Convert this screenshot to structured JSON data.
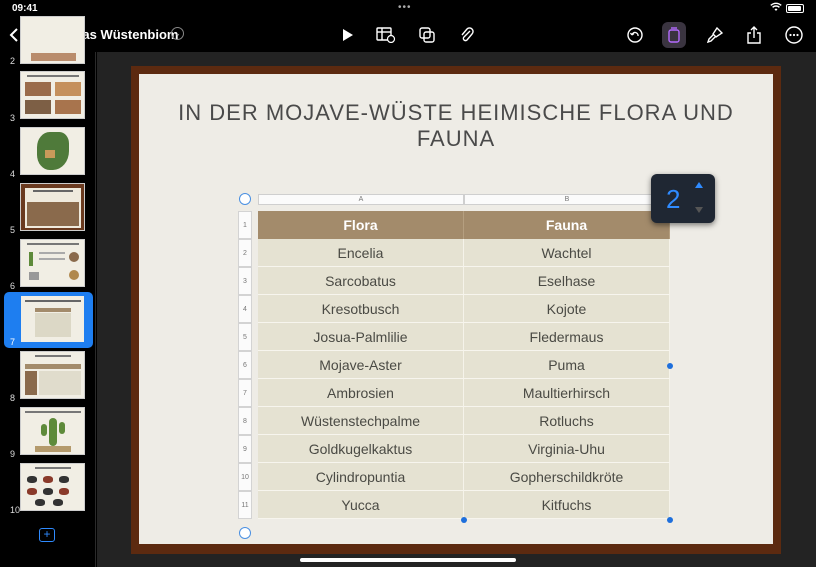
{
  "status": {
    "time": "09:41"
  },
  "toolbar": {
    "doc_title": "Das Wüstenbiom"
  },
  "sidebar": {
    "slides": [
      {
        "num": "2"
      },
      {
        "num": "3"
      },
      {
        "num": "4"
      },
      {
        "num": "5"
      },
      {
        "num": "6"
      },
      {
        "num": "7"
      },
      {
        "num": "8"
      },
      {
        "num": "9"
      },
      {
        "num": "10"
      }
    ]
  },
  "slide": {
    "title": "IN DER MOJAVE-WÜSTE HEIMISCHE FLORA UND FAUNA",
    "table": {
      "col_labels": [
        "A",
        "B"
      ],
      "headers": [
        "Flora",
        "Fauna"
      ],
      "row_labels": [
        "1",
        "2",
        "3",
        "4",
        "5",
        "6",
        "7",
        "8",
        "9",
        "10",
        "11"
      ],
      "rows": [
        [
          "Encelia",
          "Wachtel"
        ],
        [
          "Sarcobatus",
          "Eselhase"
        ],
        [
          "Kresotbusch",
          "Kojote"
        ],
        [
          "Josua-Palmlilie",
          "Fledermaus"
        ],
        [
          "Mojave-Aster",
          "Puma"
        ],
        [
          "Ambrosien",
          "Maultierhirsch"
        ],
        [
          "Wüstenstechpalme",
          "Rotluchs"
        ],
        [
          "Goldkugelkaktus",
          "Virginia-Uhu"
        ],
        [
          "Cylindropuntia",
          "Gopherschildkröte"
        ],
        [
          "Yucca",
          "Kitfuchs"
        ]
      ]
    }
  },
  "stepper": {
    "value": "2"
  },
  "colors": {
    "accent": "#2f8bff",
    "header_fill": "#a38b6b",
    "cell_fill": "#e5e2d2",
    "frame": "#5c2a10"
  }
}
